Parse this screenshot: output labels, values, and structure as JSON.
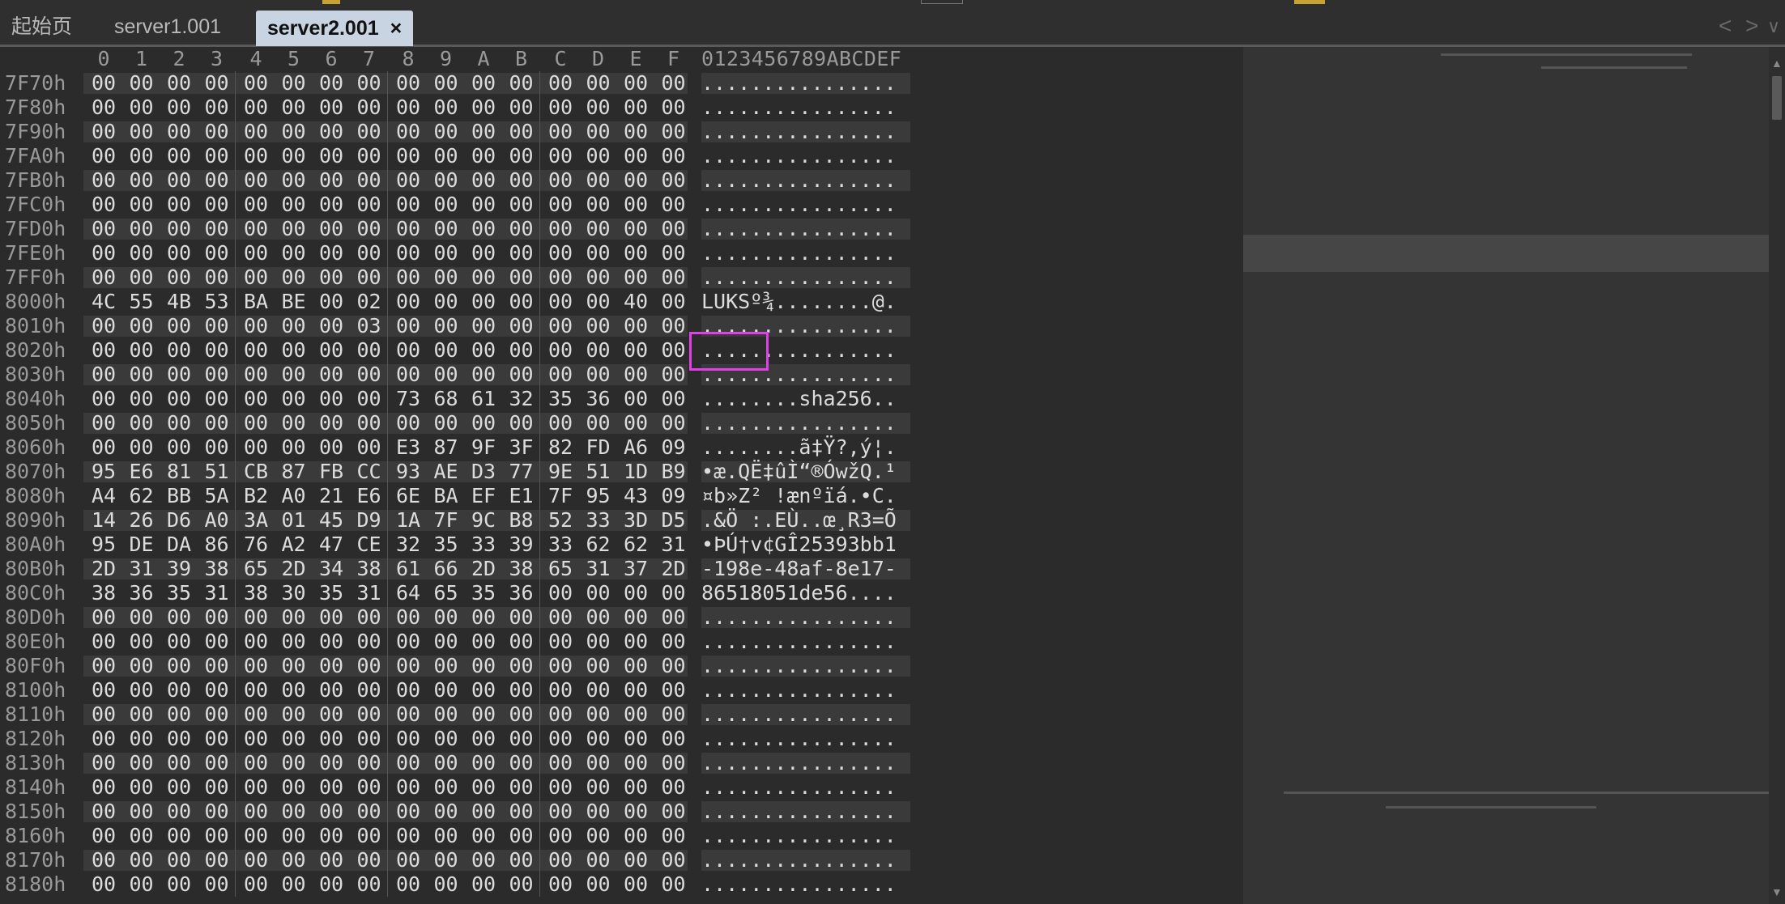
{
  "tabs": [
    {
      "label": "起始页"
    },
    {
      "label": "server1.001"
    },
    {
      "label": "server2.001",
      "close": "×"
    }
  ],
  "nav": {
    "back": "<",
    "forward": ">",
    "more": "∨"
  },
  "column_headers": [
    "0",
    "1",
    "2",
    "3",
    "4",
    "5",
    "6",
    "7",
    "8",
    "9",
    "A",
    "B",
    "C",
    "D",
    "E",
    "F"
  ],
  "ascii_header": "0123456789ABCDEF",
  "rows": [
    {
      "addr": "7F70h",
      "bytes": [
        "00",
        "00",
        "00",
        "00",
        "00",
        "00",
        "00",
        "00",
        "00",
        "00",
        "00",
        "00",
        "00",
        "00",
        "00",
        "00"
      ],
      "ascii": "................"
    },
    {
      "addr": "7F80h",
      "bytes": [
        "00",
        "00",
        "00",
        "00",
        "00",
        "00",
        "00",
        "00",
        "00",
        "00",
        "00",
        "00",
        "00",
        "00",
        "00",
        "00"
      ],
      "ascii": "................"
    },
    {
      "addr": "7F90h",
      "bytes": [
        "00",
        "00",
        "00",
        "00",
        "00",
        "00",
        "00",
        "00",
        "00",
        "00",
        "00",
        "00",
        "00",
        "00",
        "00",
        "00"
      ],
      "ascii": "................"
    },
    {
      "addr": "7FA0h",
      "bytes": [
        "00",
        "00",
        "00",
        "00",
        "00",
        "00",
        "00",
        "00",
        "00",
        "00",
        "00",
        "00",
        "00",
        "00",
        "00",
        "00"
      ],
      "ascii": "................"
    },
    {
      "addr": "7FB0h",
      "bytes": [
        "00",
        "00",
        "00",
        "00",
        "00",
        "00",
        "00",
        "00",
        "00",
        "00",
        "00",
        "00",
        "00",
        "00",
        "00",
        "00"
      ],
      "ascii": "................"
    },
    {
      "addr": "7FC0h",
      "bytes": [
        "00",
        "00",
        "00",
        "00",
        "00",
        "00",
        "00",
        "00",
        "00",
        "00",
        "00",
        "00",
        "00",
        "00",
        "00",
        "00"
      ],
      "ascii": "................"
    },
    {
      "addr": "7FD0h",
      "bytes": [
        "00",
        "00",
        "00",
        "00",
        "00",
        "00",
        "00",
        "00",
        "00",
        "00",
        "00",
        "00",
        "00",
        "00",
        "00",
        "00"
      ],
      "ascii": "................"
    },
    {
      "addr": "7FE0h",
      "bytes": [
        "00",
        "00",
        "00",
        "00",
        "00",
        "00",
        "00",
        "00",
        "00",
        "00",
        "00",
        "00",
        "00",
        "00",
        "00",
        "00"
      ],
      "ascii": "................"
    },
    {
      "addr": "7FF0h",
      "bytes": [
        "00",
        "00",
        "00",
        "00",
        "00",
        "00",
        "00",
        "00",
        "00",
        "00",
        "00",
        "00",
        "00",
        "00",
        "00",
        "00"
      ],
      "ascii": "................"
    },
    {
      "addr": "8000h",
      "bytes": [
        "4C",
        "55",
        "4B",
        "53",
        "BA",
        "BE",
        "00",
        "02",
        "00",
        "00",
        "00",
        "00",
        "00",
        "00",
        "40",
        "00"
      ],
      "ascii": "LUKSº¾........@."
    },
    {
      "addr": "8010h",
      "bytes": [
        "00",
        "00",
        "00",
        "00",
        "00",
        "00",
        "00",
        "03",
        "00",
        "00",
        "00",
        "00",
        "00",
        "00",
        "00",
        "00"
      ],
      "ascii": "................"
    },
    {
      "addr": "8020h",
      "bytes": [
        "00",
        "00",
        "00",
        "00",
        "00",
        "00",
        "00",
        "00",
        "00",
        "00",
        "00",
        "00",
        "00",
        "00",
        "00",
        "00"
      ],
      "ascii": "................"
    },
    {
      "addr": "8030h",
      "bytes": [
        "00",
        "00",
        "00",
        "00",
        "00",
        "00",
        "00",
        "00",
        "00",
        "00",
        "00",
        "00",
        "00",
        "00",
        "00",
        "00"
      ],
      "ascii": "................"
    },
    {
      "addr": "8040h",
      "bytes": [
        "00",
        "00",
        "00",
        "00",
        "00",
        "00",
        "00",
        "00",
        "73",
        "68",
        "61",
        "32",
        "35",
        "36",
        "00",
        "00"
      ],
      "ascii": "........sha256.."
    },
    {
      "addr": "8050h",
      "bytes": [
        "00",
        "00",
        "00",
        "00",
        "00",
        "00",
        "00",
        "00",
        "00",
        "00",
        "00",
        "00",
        "00",
        "00",
        "00",
        "00"
      ],
      "ascii": "................"
    },
    {
      "addr": "8060h",
      "bytes": [
        "00",
        "00",
        "00",
        "00",
        "00",
        "00",
        "00",
        "00",
        "E3",
        "87",
        "9F",
        "3F",
        "82",
        "FD",
        "A6",
        "09"
      ],
      "ascii": "........ã‡Ÿ?‚ý¦."
    },
    {
      "addr": "8070h",
      "bytes": [
        "95",
        "E6",
        "81",
        "51",
        "CB",
        "87",
        "FB",
        "CC",
        "93",
        "AE",
        "D3",
        "77",
        "9E",
        "51",
        "1D",
        "B9"
      ],
      "ascii": "•æ.QË‡ûÌ“®ÓwžQ.¹"
    },
    {
      "addr": "8080h",
      "bytes": [
        "A4",
        "62",
        "BB",
        "5A",
        "B2",
        "A0",
        "21",
        "E6",
        "6E",
        "BA",
        "EF",
        "E1",
        "7F",
        "95",
        "43",
        "09"
      ],
      "ascii": "¤b»Z² !ænºïá.•C."
    },
    {
      "addr": "8090h",
      "bytes": [
        "14",
        "26",
        "D6",
        "A0",
        "3A",
        "01",
        "45",
        "D9",
        "1A",
        "7F",
        "9C",
        "B8",
        "52",
        "33",
        "3D",
        "D5"
      ],
      "ascii": ".&Ö :.EÙ..œ¸R3=Õ"
    },
    {
      "addr": "80A0h",
      "bytes": [
        "95",
        "DE",
        "DA",
        "86",
        "76",
        "A2",
        "47",
        "CE",
        "32",
        "35",
        "33",
        "39",
        "33",
        "62",
        "62",
        "31"
      ],
      "ascii": "•ÞÚ†v¢GÎ25393bb1"
    },
    {
      "addr": "80B0h",
      "bytes": [
        "2D",
        "31",
        "39",
        "38",
        "65",
        "2D",
        "34",
        "38",
        "61",
        "66",
        "2D",
        "38",
        "65",
        "31",
        "37",
        "2D"
      ],
      "ascii": "-198e-48af-8e17-"
    },
    {
      "addr": "80C0h",
      "bytes": [
        "38",
        "36",
        "35",
        "31",
        "38",
        "30",
        "35",
        "31",
        "64",
        "65",
        "35",
        "36",
        "00",
        "00",
        "00",
        "00"
      ],
      "ascii": "86518051de56...."
    },
    {
      "addr": "80D0h",
      "bytes": [
        "00",
        "00",
        "00",
        "00",
        "00",
        "00",
        "00",
        "00",
        "00",
        "00",
        "00",
        "00",
        "00",
        "00",
        "00",
        "00"
      ],
      "ascii": "................"
    },
    {
      "addr": "80E0h",
      "bytes": [
        "00",
        "00",
        "00",
        "00",
        "00",
        "00",
        "00",
        "00",
        "00",
        "00",
        "00",
        "00",
        "00",
        "00",
        "00",
        "00"
      ],
      "ascii": "................"
    },
    {
      "addr": "80F0h",
      "bytes": [
        "00",
        "00",
        "00",
        "00",
        "00",
        "00",
        "00",
        "00",
        "00",
        "00",
        "00",
        "00",
        "00",
        "00",
        "00",
        "00"
      ],
      "ascii": "................"
    },
    {
      "addr": "8100h",
      "bytes": [
        "00",
        "00",
        "00",
        "00",
        "00",
        "00",
        "00",
        "00",
        "00",
        "00",
        "00",
        "00",
        "00",
        "00",
        "00",
        "00"
      ],
      "ascii": "................"
    },
    {
      "addr": "8110h",
      "bytes": [
        "00",
        "00",
        "00",
        "00",
        "00",
        "00",
        "00",
        "00",
        "00",
        "00",
        "00",
        "00",
        "00",
        "00",
        "00",
        "00"
      ],
      "ascii": "................"
    },
    {
      "addr": "8120h",
      "bytes": [
        "00",
        "00",
        "00",
        "00",
        "00",
        "00",
        "00",
        "00",
        "00",
        "00",
        "00",
        "00",
        "00",
        "00",
        "00",
        "00"
      ],
      "ascii": "................"
    },
    {
      "addr": "8130h",
      "bytes": [
        "00",
        "00",
        "00",
        "00",
        "00",
        "00",
        "00",
        "00",
        "00",
        "00",
        "00",
        "00",
        "00",
        "00",
        "00",
        "00"
      ],
      "ascii": "................"
    },
    {
      "addr": "8140h",
      "bytes": [
        "00",
        "00",
        "00",
        "00",
        "00",
        "00",
        "00",
        "00",
        "00",
        "00",
        "00",
        "00",
        "00",
        "00",
        "00",
        "00"
      ],
      "ascii": "................"
    },
    {
      "addr": "8150h",
      "bytes": [
        "00",
        "00",
        "00",
        "00",
        "00",
        "00",
        "00",
        "00",
        "00",
        "00",
        "00",
        "00",
        "00",
        "00",
        "00",
        "00"
      ],
      "ascii": "................"
    },
    {
      "addr": "8160h",
      "bytes": [
        "00",
        "00",
        "00",
        "00",
        "00",
        "00",
        "00",
        "00",
        "00",
        "00",
        "00",
        "00",
        "00",
        "00",
        "00",
        "00"
      ],
      "ascii": "................"
    },
    {
      "addr": "8170h",
      "bytes": [
        "00",
        "00",
        "00",
        "00",
        "00",
        "00",
        "00",
        "00",
        "00",
        "00",
        "00",
        "00",
        "00",
        "00",
        "00",
        "00"
      ],
      "ascii": "................"
    },
    {
      "addr": "8180h",
      "bytes": [
        "00",
        "00",
        "00",
        "00",
        "00",
        "00",
        "00",
        "00",
        "00",
        "00",
        "00",
        "00",
        "00",
        "00",
        "00",
        "00"
      ],
      "ascii": "................"
    }
  ],
  "highlight": {
    "color": "#e040e8"
  },
  "colors": {
    "background": "#2b2b2b",
    "active_tab": "#c9d4e2",
    "minimap": "#343434"
  }
}
